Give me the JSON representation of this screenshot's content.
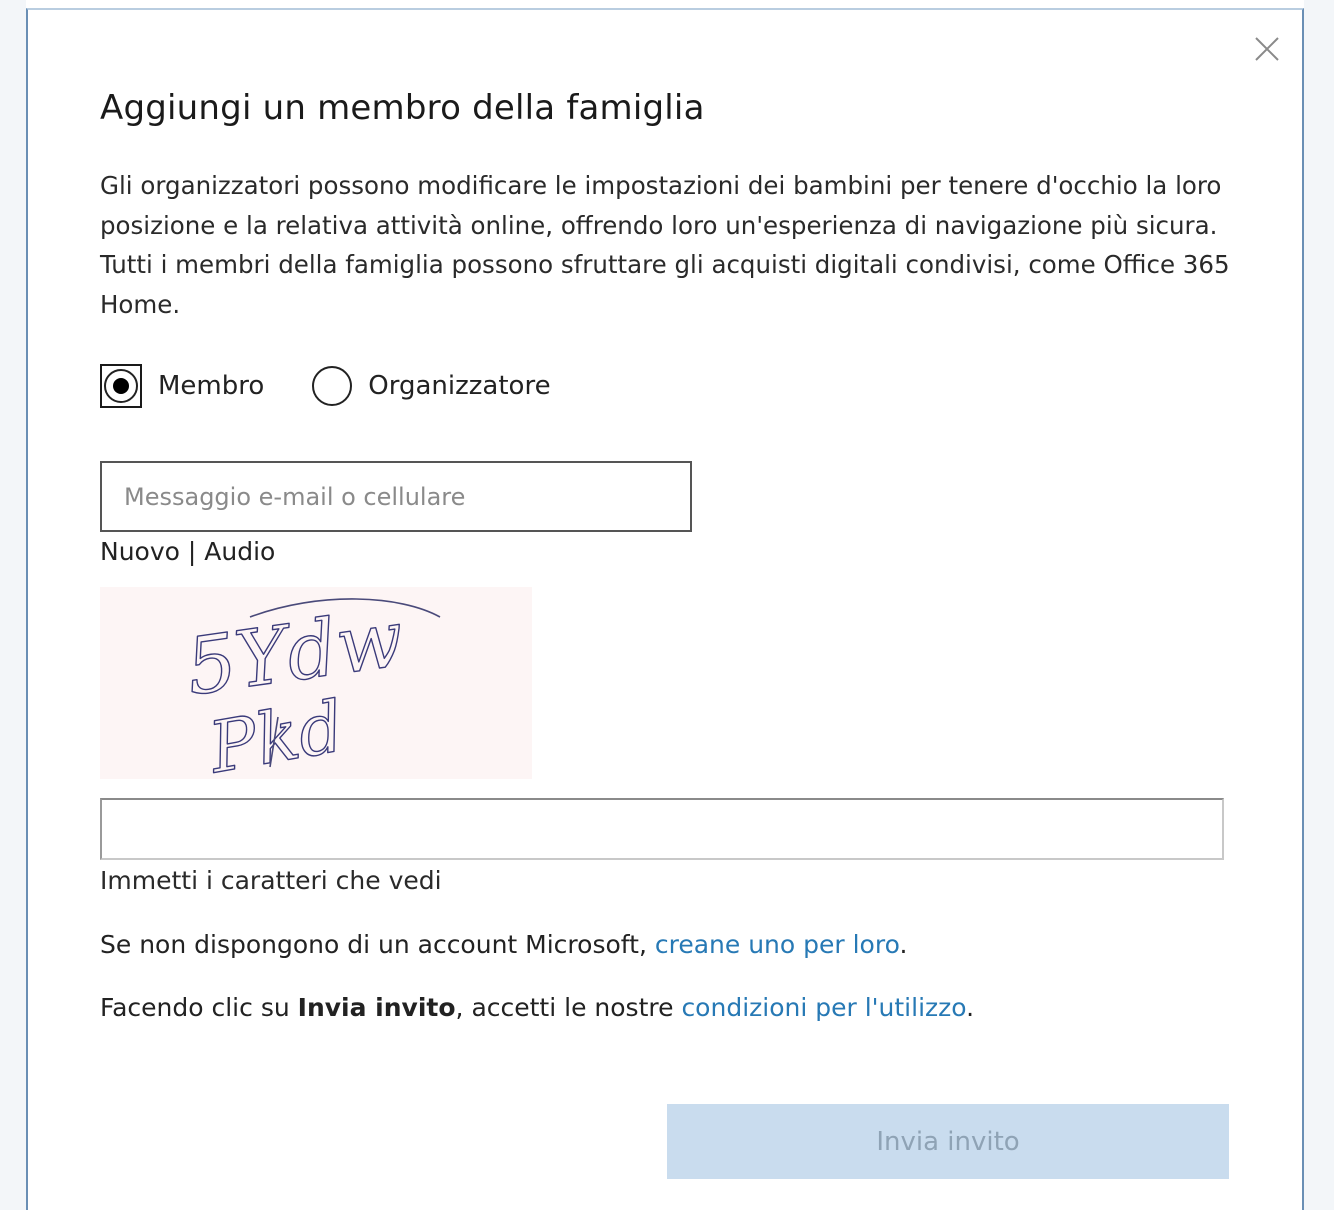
{
  "dialog": {
    "title": "Aggiungi un membro della famiglia",
    "description": "Gli organizzatori possono modificare le impostazioni dei bambini per tenere d'occhio la loro posizione e la relativa attività online, offrendo loro un'esperienza di navigazione più sicura. Tutti i membri della famiglia possono sfruttare gli acquisti digitali condivisi, come Office 365 Home.",
    "close_icon": "close-icon"
  },
  "role": {
    "options": [
      {
        "label": "Membro",
        "selected": true
      },
      {
        "label": "Organizzatore",
        "selected": false
      }
    ]
  },
  "email": {
    "placeholder": "Messaggio e-mail o cellulare",
    "value": ""
  },
  "captcha": {
    "new_label": "Nuovo",
    "separator": "|",
    "audio_label": "Audio",
    "image_text": "5Ydw Pkd",
    "input_value": "",
    "hint": "Immetti i caratteri che vedi"
  },
  "notice": {
    "no_account_text": "Se non dispongono di un account Microsoft,",
    "create_link": "creane uno per loro",
    "create_suffix": ".",
    "terms_prefix": "Facendo clic su",
    "terms_bold": "Invia invito",
    "terms_middle": ", accetti le nostre",
    "terms_link": "condizioni per l'utilizzo",
    "terms_suffix": "."
  },
  "actions": {
    "send_label": "Invia invito",
    "send_enabled": false
  },
  "colors": {
    "link": "#2779b5",
    "button_disabled_bg": "#c9dcee",
    "dialog_border": "#6a8fb5"
  }
}
